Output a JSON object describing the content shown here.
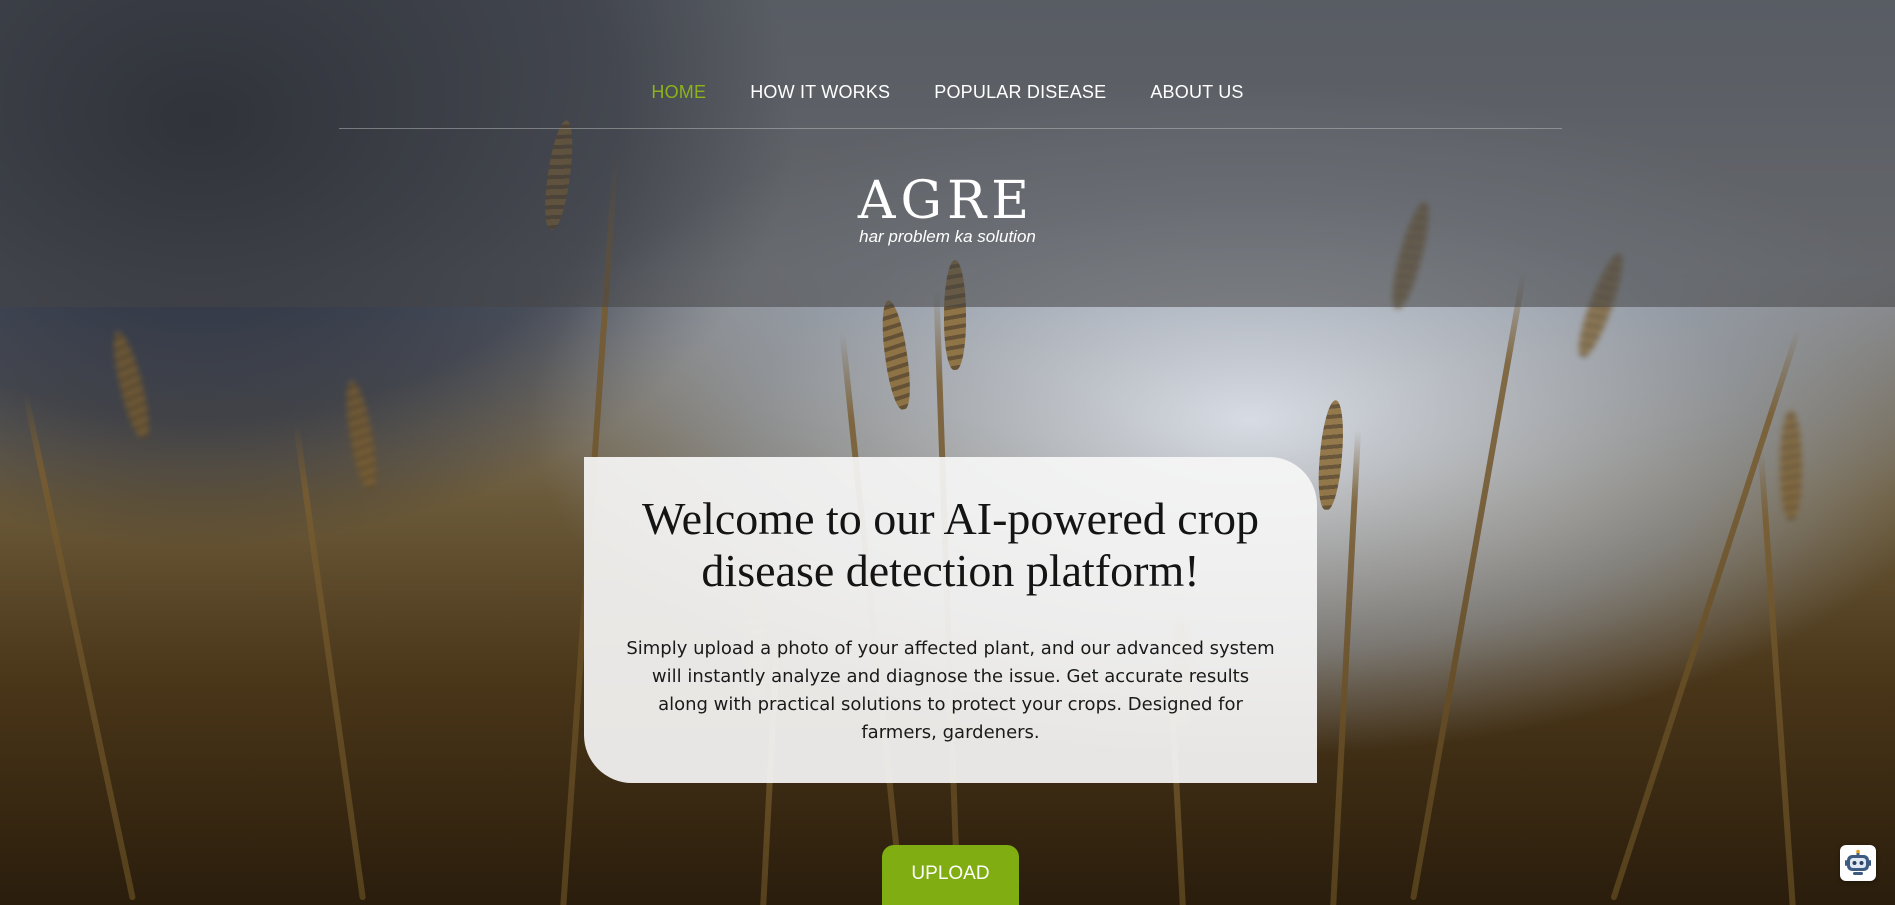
{
  "nav": {
    "items": [
      {
        "label": "HOME",
        "active": true
      },
      {
        "label": "HOW IT WORKS",
        "active": false
      },
      {
        "label": "POPULAR DISEASE",
        "active": false
      },
      {
        "label": "ABOUT US",
        "active": false
      }
    ]
  },
  "brand": {
    "title": "AGRE",
    "tagline": "har problem ka solution"
  },
  "hero": {
    "heading": "Welcome to our AI-powered crop disease detection platform!",
    "body": "Simply upload a photo of your affected plant, and our advanced system will instantly analyze and diagnose the issue. Get accurate results along with practical solutions to protect your crops. Designed for farmers, gardeners.",
    "upload_label": "UPLOAD"
  },
  "widgets": {
    "chatbot_icon": "robot-icon"
  },
  "colors": {
    "accent": "#7fad12",
    "nav_active": "#8db21b",
    "header_overlay": "rgba(70,70,70,0.55)"
  }
}
